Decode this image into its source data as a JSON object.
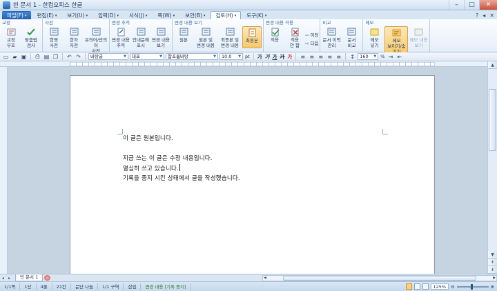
{
  "window": {
    "title": "빈 문서 1 - 한컴오피스 한글",
    "minimize": "–",
    "maximize": "□",
    "close": "✕"
  },
  "menu": {
    "tabs": [
      {
        "label": "파일(F)",
        "file": true
      },
      {
        "label": "편집(E)"
      },
      {
        "label": "보기(U)"
      },
      {
        "label": "입력(D)"
      },
      {
        "label": "서식(J)"
      },
      {
        "label": "쪽(W)"
      },
      {
        "label": "보안(B)"
      },
      {
        "label": "검토(H)",
        "active": true
      },
      {
        "label": "도구(K)"
      }
    ],
    "right_icons": [
      "question-icon",
      "arrow-icon",
      "close-icon"
    ]
  },
  "ribbon": {
    "groups": [
      {
        "title": "교정",
        "buttons": [
          {
            "label": "교정\n부호",
            "icon": "proofreading-icon"
          },
          {
            "label": "맞춤법\n검사",
            "icon": "spellcheck-icon"
          }
        ]
      },
      {
        "title": "사전",
        "buttons": [
          {
            "label": "한영\n사전",
            "icon": "korean-english-dictionary-icon"
          },
          {
            "label": "한자\n자전",
            "icon": "chinese-dictionary-icon"
          },
          {
            "label": "유의어/반의어\n사전",
            "icon": "thesaurus-icon"
          }
        ]
      },
      {
        "title": "변경 추적",
        "buttons": [
          {
            "label": "변경 내용\n추적",
            "icon": "track-changes-icon"
          },
          {
            "label": "안내문에\n표시",
            "icon": "balloon-icon"
          },
          {
            "label": "변경 내용\n보기",
            "icon": "view-changes-icon"
          }
        ]
      },
      {
        "title": "변경 내용 보기",
        "buttons": [
          {
            "label": "원본",
            "icon": "original-icon"
          },
          {
            "label": "원본 및\n변경 내용",
            "icon": "original-with-changes-icon"
          },
          {
            "label": "최종본 및\n변경 내용",
            "icon": "final-with-changes-icon"
          },
          {
            "label": "최종본",
            "icon": "final-icon",
            "active": true
          }
        ]
      },
      {
        "title": "변경 내용 적용",
        "buttons": [
          {
            "label": "적용",
            "icon": "apply-icon"
          },
          {
            "label": "적용\n안 함",
            "icon": "reject-icon"
          }
        ],
        "stack": [
          {
            "label": "이전",
            "icon": "previous-icon"
          },
          {
            "label": "다음",
            "icon": "next-icon"
          }
        ]
      },
      {
        "title": "비교",
        "buttons": [
          {
            "label": "문서 이력\n관리",
            "icon": "document-history-icon"
          },
          {
            "label": "문서\n비교",
            "icon": "compare-icon"
          }
        ]
      },
      {
        "title": "메모",
        "buttons": [
          {
            "label": "메모\n넣기",
            "icon": "insert-memo-icon"
          },
          {
            "label": "메모\n보이기/숨기기",
            "icon": "show-hide-memo-icon",
            "active": true
          },
          {
            "label": "메모 내용\n보기",
            "icon": "memo-content-icon",
            "disabled": true
          }
        ]
      }
    ]
  },
  "toolbar": {
    "style_combo": "바탕글",
    "lang_combo": "대표",
    "font_combo": "함초롬바탕",
    "size_combo": "10.0",
    "size_unit": "pt",
    "bold": "가",
    "italic": "가",
    "underline": "가",
    "strike": "가",
    "font_color": "가",
    "zoom_combo": "160",
    "zoom_unit": "%"
  },
  "document": {
    "lines": [
      "이 글은 원본입니다.",
      "",
      "지금 쓰는 이 글은 수정 내용입니다.",
      "열심히 쓰고 있습니다.",
      "기록을 중지 시킨 상태에서 글을 작성했습니다."
    ]
  },
  "tabs": {
    "doc_tab": "빈 문서 1"
  },
  "status": {
    "page": "1/1쪽",
    "section": "1단",
    "line": "4줄",
    "col": "21칸",
    "layout": "문단 나눔",
    "region": "1/1 구역",
    "mode": "삽입",
    "track": "변경 내용 [기록 중지]",
    "zoom": "125%"
  }
}
